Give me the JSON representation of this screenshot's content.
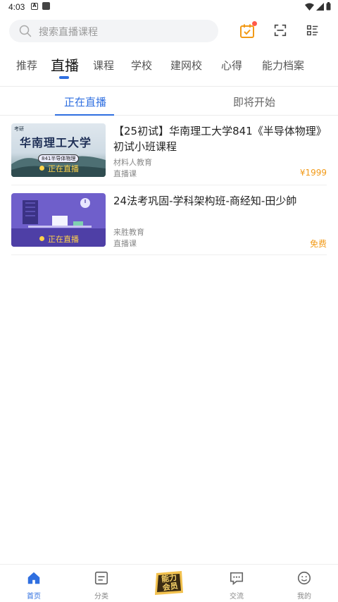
{
  "status_bar": {
    "time": "4:03",
    "a_icon": "A"
  },
  "search": {
    "placeholder": "搜索直播课程"
  },
  "nav_tabs": [
    {
      "label": "推荐"
    },
    {
      "label": "直播"
    },
    {
      "label": "课程"
    },
    {
      "label": "学校"
    },
    {
      "label": "建网校"
    },
    {
      "label": "心得"
    },
    {
      "label": "能力档案"
    }
  ],
  "sub_tabs": [
    {
      "label": "正在直播"
    },
    {
      "label": "即将开始"
    }
  ],
  "courses": [
    {
      "title": "【25初试】华南理工大学841《半导体物理》初试小班课程",
      "org": "材料人教育",
      "type": "直播课",
      "price": "¥1999",
      "thumb_title": "华南理工大学",
      "thumb_sub": "841半导体物理",
      "thumb_kaoyan": "考研",
      "live_label": "正在直播"
    },
    {
      "title": "24法考巩固-学科架构班-商经知-田少帥",
      "org": "来胜教育",
      "type": "直播课",
      "price": "免费",
      "live_label": "正在直播"
    }
  ],
  "bottom_nav": [
    {
      "label": "首页"
    },
    {
      "label": "分类"
    },
    {
      "label": "能力会员"
    },
    {
      "label": "交流"
    },
    {
      "label": "我的"
    }
  ],
  "colors": {
    "accent": "#2f6fe0",
    "price": "#f29a17",
    "live": "#ffd24a"
  }
}
